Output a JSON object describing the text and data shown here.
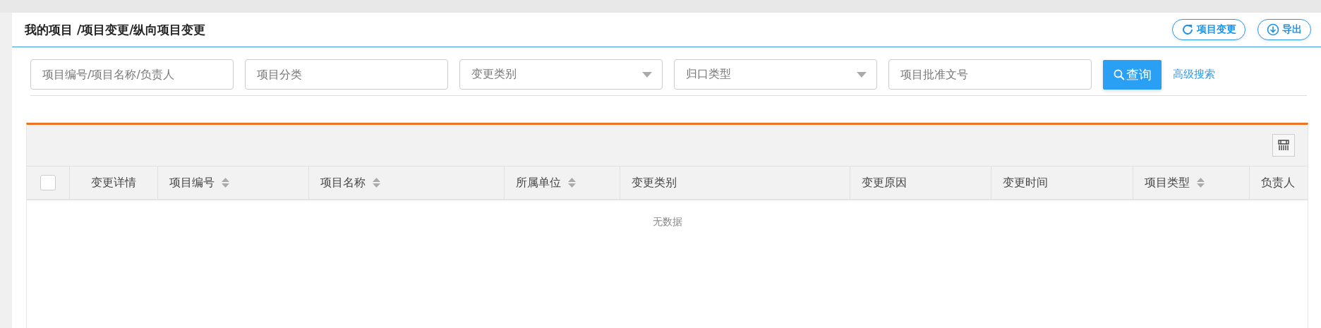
{
  "breadcrumb": "我的项目 /项目变更/纵向项目变更",
  "header_buttons": [
    {
      "label": "项目变更",
      "kind": "refresh"
    },
    {
      "label": "导出",
      "kind": "download"
    }
  ],
  "filters": [
    {
      "kind": "input",
      "placeholder": "项目编号/项目名称/负责人"
    },
    {
      "kind": "input",
      "placeholder": "项目分类"
    },
    {
      "kind": "select",
      "placeholder": "变更类别"
    },
    {
      "kind": "select",
      "placeholder": "归口类型"
    },
    {
      "kind": "input",
      "placeholder": "项目批准文号"
    }
  ],
  "search_button": "查询",
  "advanced_search": "高级搜索",
  "table": {
    "select_all": {
      "checked": false
    },
    "columns": [
      {
        "label": "变更详情",
        "sortable": false
      },
      {
        "label": "项目编号",
        "sortable": true
      },
      {
        "label": "项目名称",
        "sortable": true
      },
      {
        "label": "所属单位",
        "sortable": true
      },
      {
        "label": "变更类别",
        "sortable": false
      },
      {
        "label": "变更原因",
        "sortable": false
      },
      {
        "label": "变更时间",
        "sortable": false
      },
      {
        "label": "项目类型",
        "sortable": true
      },
      {
        "label": "负责人",
        "sortable": false
      }
    ],
    "empty_text": "无数据"
  }
}
